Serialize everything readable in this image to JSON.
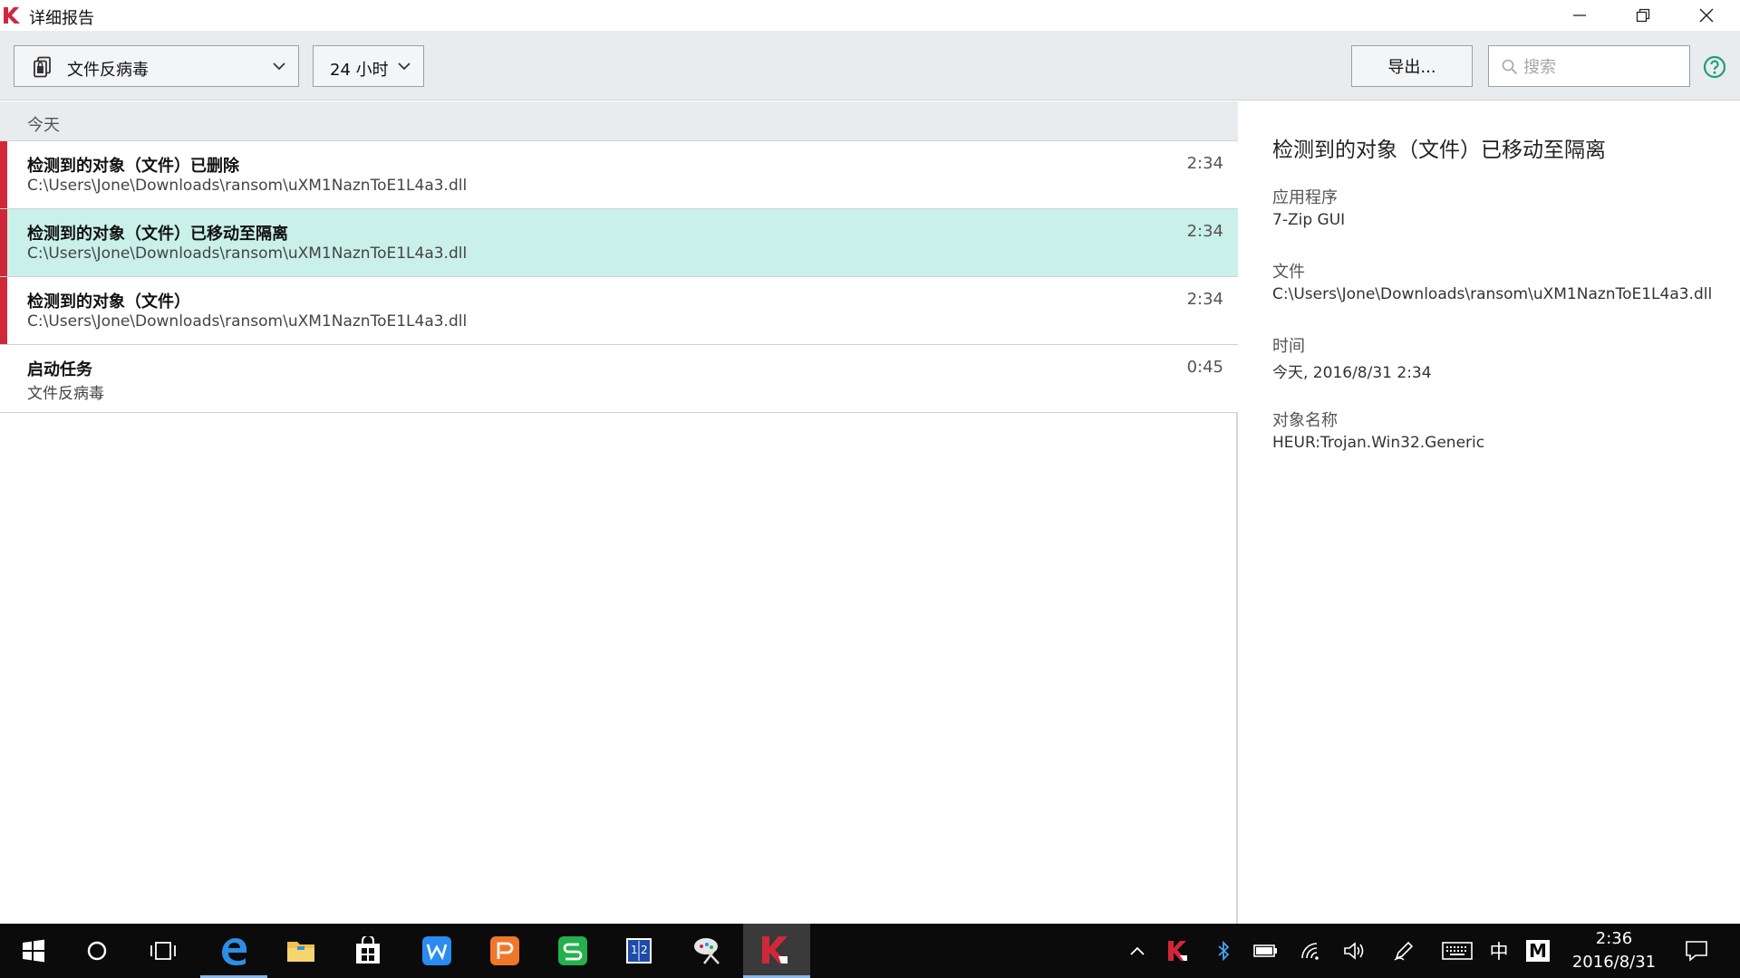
{
  "window": {
    "title": "详细报告"
  },
  "toolbar": {
    "component_dropdown": "文件反病毒",
    "period_dropdown": "24 小时",
    "export_label": "导出...",
    "search_placeholder": "搜索"
  },
  "list": {
    "group_header": "今天",
    "rows": [
      {
        "title": "检测到的对象（文件）已删除",
        "subtitle": "C:\\Users\\Jone\\Downloads\\ransom\\uXM1NaznToE1L4a3.dll",
        "time": "2:34",
        "severity": "critical",
        "selected": false
      },
      {
        "title": "检测到的对象（文件）已移动至隔离",
        "subtitle": "C:\\Users\\Jone\\Downloads\\ransom\\uXM1NaznToE1L4a3.dll",
        "time": "2:34",
        "severity": "critical",
        "selected": true
      },
      {
        "title": "检测到的对象（文件）",
        "subtitle": "C:\\Users\\Jone\\Downloads\\ransom\\uXM1NaznToE1L4a3.dll",
        "time": "2:34",
        "severity": "critical",
        "selected": false
      },
      {
        "title": "启动任务",
        "subtitle": "文件反病毒",
        "time": "0:45",
        "severity": "none",
        "selected": false
      }
    ]
  },
  "detail": {
    "title": "检测到的对象（文件）已移动至隔离",
    "fields": [
      {
        "label": "应用程序",
        "value": "7-Zip GUI"
      },
      {
        "label": "文件",
        "value": "C:\\Users\\Jone\\Downloads\\ransom\\uXM1NaznToE1L4a3.dll"
      },
      {
        "label": "时间",
        "value": "今天, 2016/8/31 2:34"
      },
      {
        "label": "对象名称",
        "value": "HEUR:Trojan.Win32.Generic"
      }
    ]
  },
  "taskbar": {
    "ime_label": "中",
    "ime_mode": "M",
    "clock_time": "2:36",
    "clock_date": "2016/8/31"
  },
  "colors": {
    "severity_critical": "#d0283a",
    "selected_row": "#c9f0e9",
    "toolbar_bg": "#e9ecee",
    "help_icon": "#1e9e7a"
  }
}
